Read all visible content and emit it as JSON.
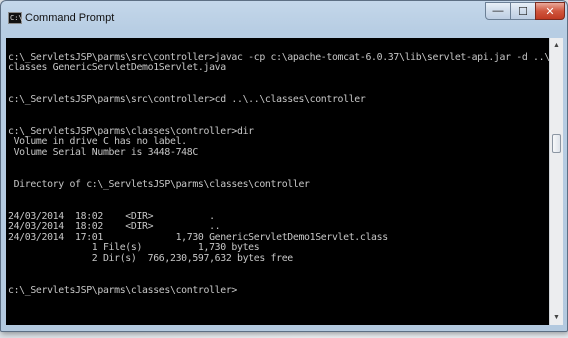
{
  "window": {
    "title": "Command Prompt",
    "icon_name": "cmd-app-icon",
    "icon_glyph": "C:\\",
    "controls": {
      "minimize": "—",
      "maximize": "☐",
      "close": "✕"
    }
  },
  "console": {
    "lines": [
      "",
      "c:\\_ServletsJSP\\parms\\src\\controller>javac -cp c:\\apache-tomcat-6.0.37\\lib\\servlet-api.jar -d ..\\..\\",
      "classes GenericServletDemo1Servlet.java",
      "",
      "",
      "c:\\_ServletsJSP\\parms\\src\\controller>cd ..\\..\\classes\\controller",
      "",
      "",
      "c:\\_ServletsJSP\\parms\\classes\\controller>dir",
      " Volume in drive C has no label.",
      " Volume Serial Number is 3448-748C",
      "",
      "",
      " Directory of c:\\_ServletsJSP\\parms\\classes\\controller",
      "",
      "",
      "24/03/2014  18:02    <DIR>          .",
      "24/03/2014  18:02    <DIR>          ..",
      "24/03/2014  17:01             1,730 GenericServletDemo1Servlet.class",
      "               1 File(s)          1,730 bytes",
      "               2 Dir(s)  766,230,597,632 bytes free",
      "",
      "",
      "c:\\_ServletsJSP\\parms\\classes\\controller>"
    ]
  },
  "scrollbar": {
    "up_glyph": "▲",
    "down_glyph": "▼"
  }
}
